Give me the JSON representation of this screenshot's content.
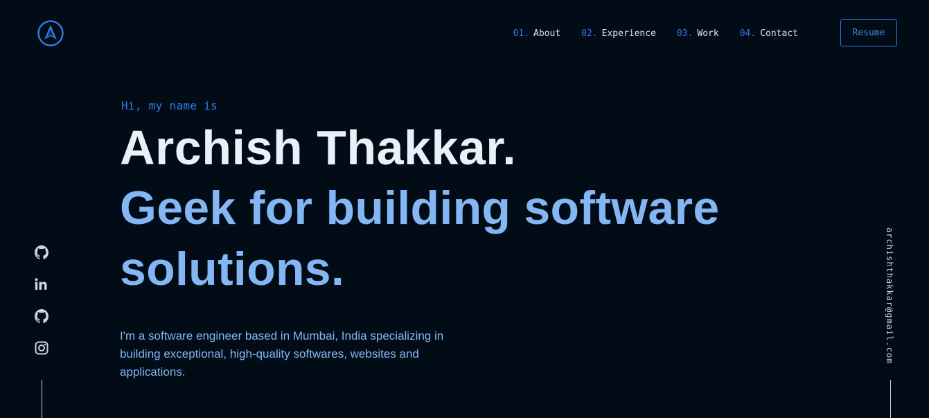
{
  "header": {
    "logo_icon": "triangle-a-logo-icon",
    "nav": [
      {
        "num": "01.",
        "label": "About"
      },
      {
        "num": "02.",
        "label": "Experience"
      },
      {
        "num": "03.",
        "label": "Work"
      },
      {
        "num": "04.",
        "label": "Contact"
      }
    ],
    "resume_label": "Resume"
  },
  "hero": {
    "intro": "Hi, my name is",
    "name": "Archish Thakkar.",
    "tagline": "Geek for building software solutions.",
    "description": "I'm a software engineer based in Mumbai, India specializing in building exceptional, high-quality softwares, websites and applications."
  },
  "social": [
    {
      "icon": "github-icon"
    },
    {
      "icon": "linkedin-icon"
    },
    {
      "icon": "github-icon"
    },
    {
      "icon": "instagram-icon"
    }
  ],
  "email": "archishthakkar@gmail.com",
  "colors": {
    "background": "#020c16",
    "accent": "#2f7ae5",
    "light_blue": "#84b6f4",
    "text_light": "#e8f0fa"
  }
}
